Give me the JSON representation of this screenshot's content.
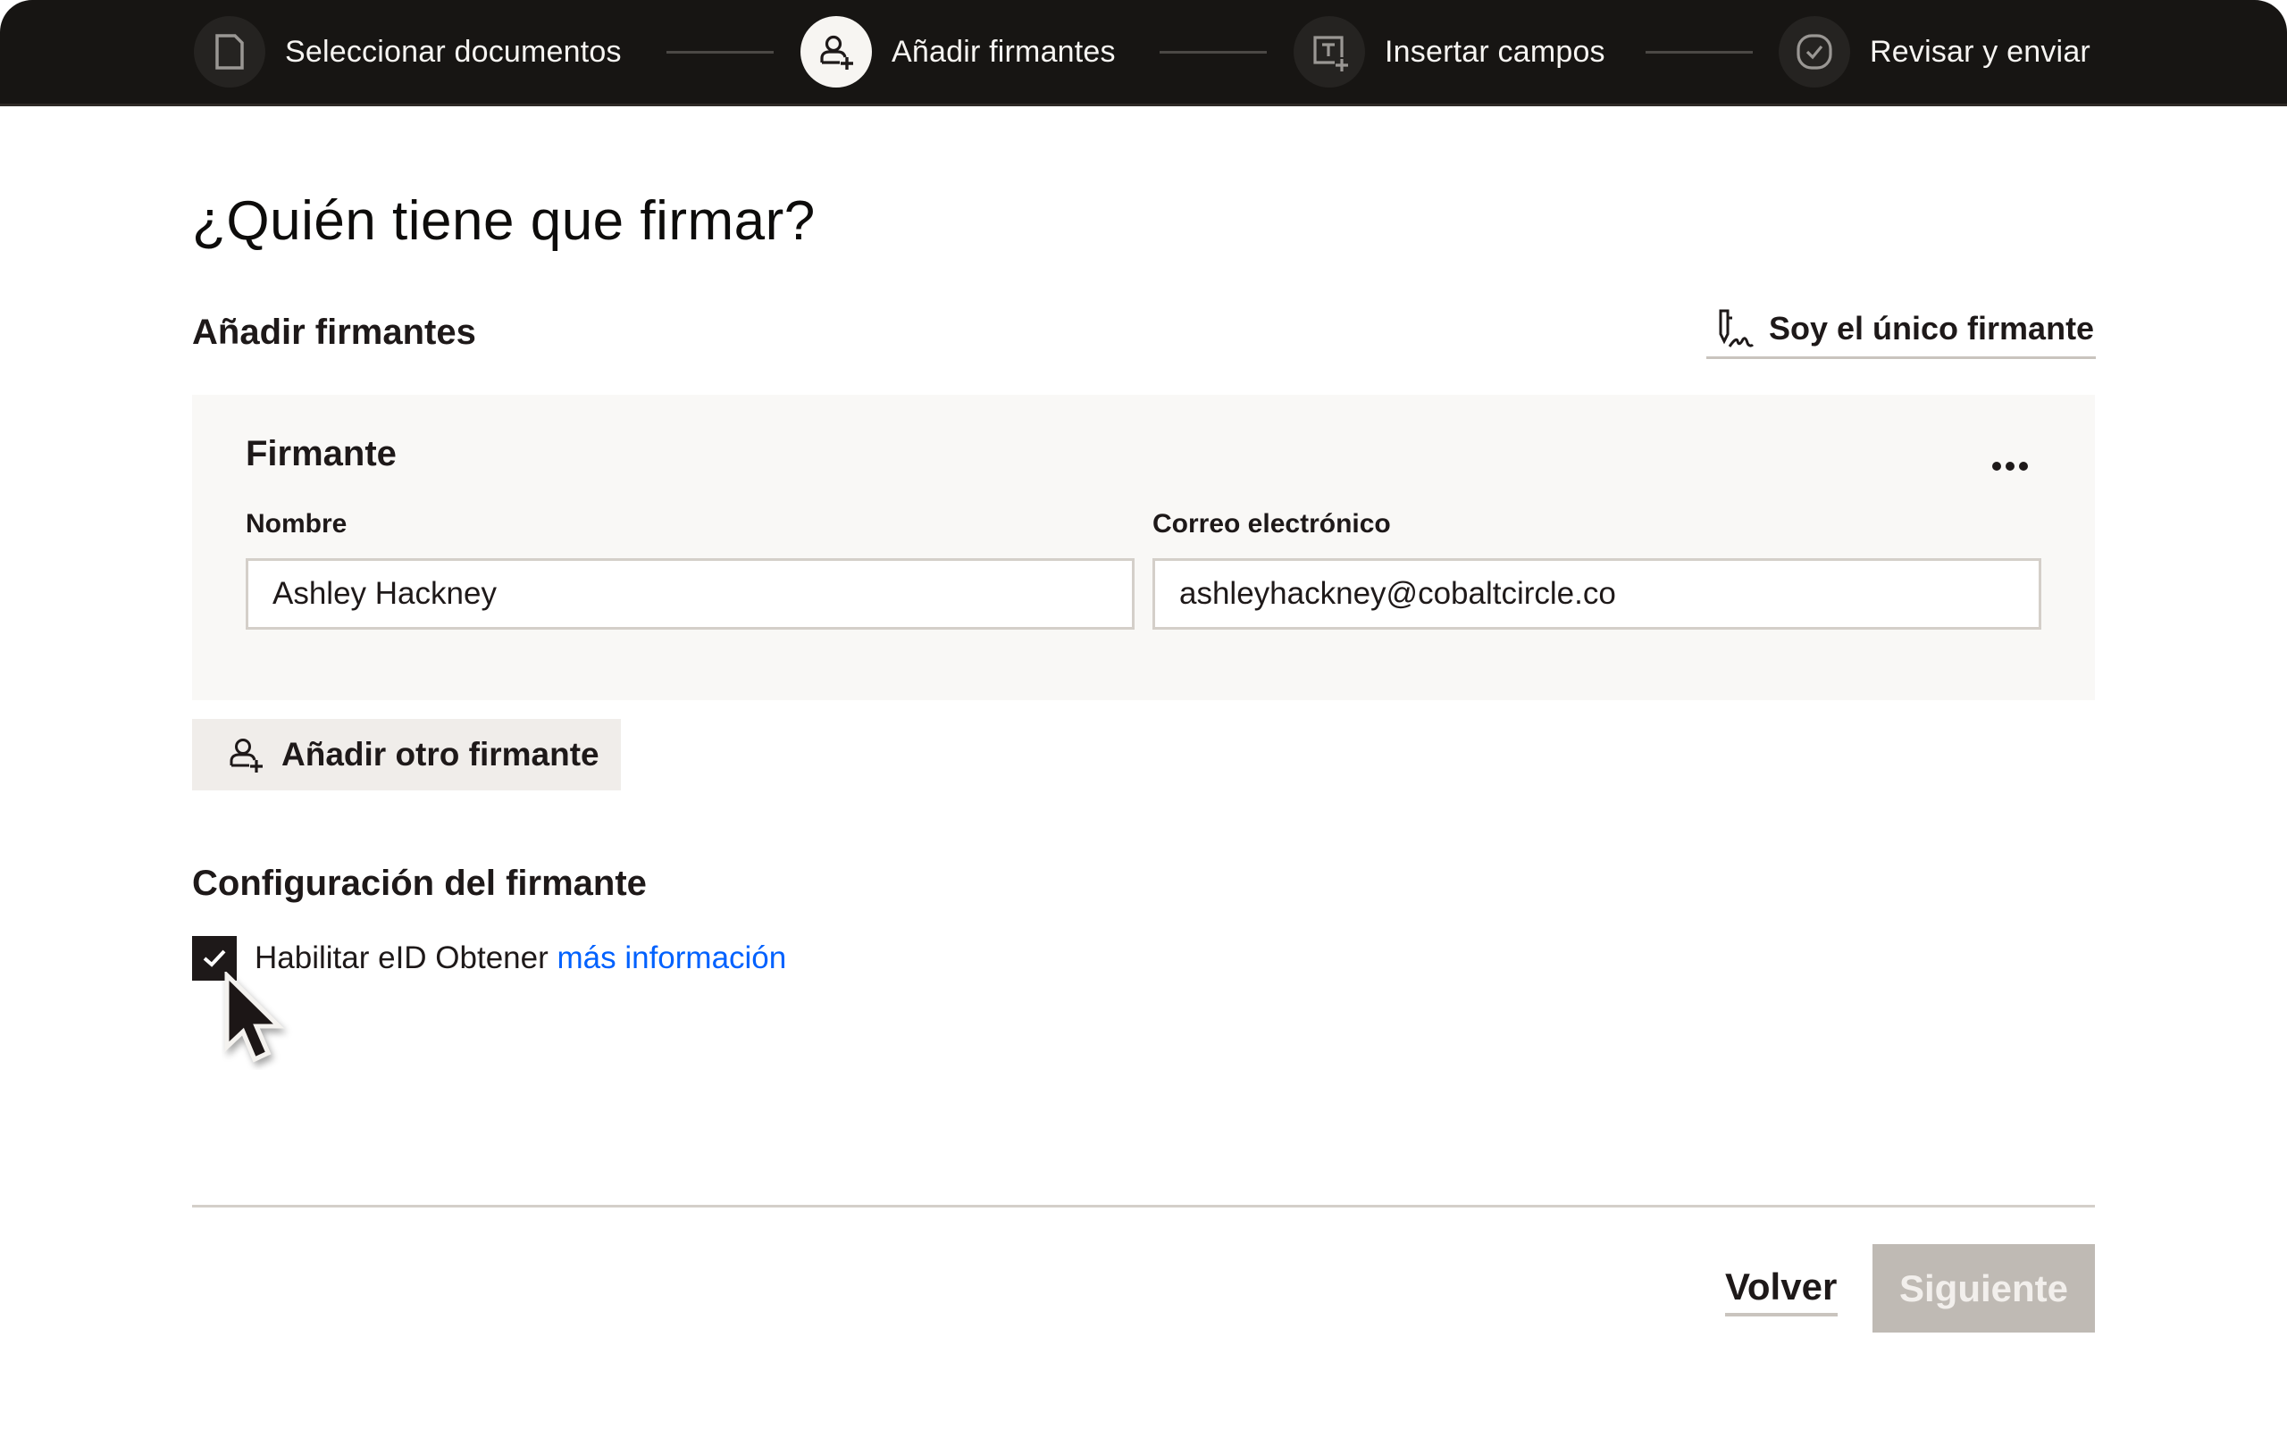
{
  "stepper": {
    "steps": [
      {
        "label": "Seleccionar documentos",
        "icon": "document-icon",
        "state": "inactive"
      },
      {
        "label": "Añadir firmantes",
        "icon": "add-person-icon",
        "state": "active"
      },
      {
        "label": "Insertar campos",
        "icon": "insert-text-field-icon",
        "state": "inactive"
      },
      {
        "label": "Revisar y enviar",
        "icon": "check-circle-icon",
        "state": "inactive"
      }
    ]
  },
  "page": {
    "title": "¿Quién tiene que firmar?",
    "section_title": "Añadir firmantes",
    "only_signer_label": "Soy el único firmante"
  },
  "signer_card": {
    "title": "Firmante",
    "name_label": "Nombre",
    "name_value": "Ashley Hackney",
    "email_label": "Correo electrónico",
    "email_value": "ashleyhackney@cobaltcircle.co"
  },
  "add_signer_label": "Añadir otro firmante",
  "settings": {
    "title": "Configuración del firmante",
    "eid_checked": true,
    "eid_label": "Habilitar eID Obtener ",
    "eid_link": "más información"
  },
  "footer": {
    "back_label": "Volver",
    "next_label": "Siguiente",
    "next_disabled": true
  },
  "colors": {
    "header_bg": "#171513",
    "link": "#0061fe",
    "disabled_button": "#bfbab4",
    "card_bg": "#f9f8f6"
  }
}
